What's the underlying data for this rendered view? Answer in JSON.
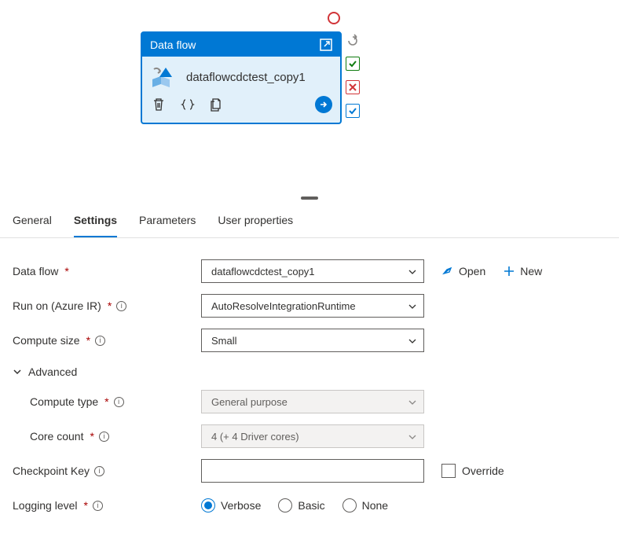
{
  "activity": {
    "header": "Data flow",
    "name": "dataflowcdctest_copy1"
  },
  "tabs": {
    "general": "General",
    "settings": "Settings",
    "parameters": "Parameters",
    "user_properties": "User properties"
  },
  "form": {
    "data_flow_label": "Data flow",
    "data_flow_value": "dataflowcdctest_copy1",
    "open_label": "Open",
    "new_label": "New",
    "run_on_label": "Run on (Azure IR)",
    "run_on_value": "AutoResolveIntegrationRuntime",
    "compute_size_label": "Compute size",
    "compute_size_value": "Small",
    "advanced_label": "Advanced",
    "compute_type_label": "Compute type",
    "compute_type_value": "General purpose",
    "core_count_label": "Core count",
    "core_count_value": "4 (+ 4 Driver cores)",
    "checkpoint_label": "Checkpoint Key",
    "checkpoint_value": "",
    "override_label": "Override",
    "logging_label": "Logging level",
    "logging_options": {
      "verbose": "Verbose",
      "basic": "Basic",
      "none": "None"
    }
  }
}
